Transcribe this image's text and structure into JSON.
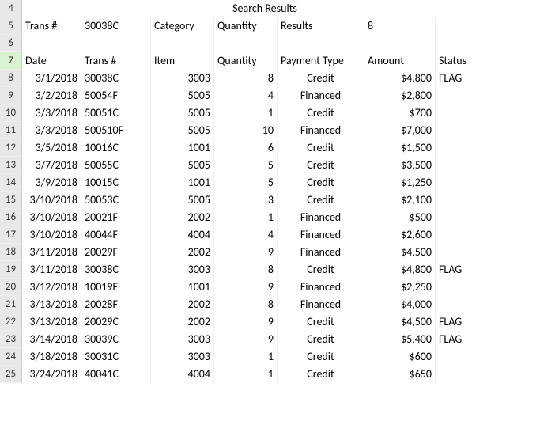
{
  "title": "Search Results",
  "rowNumbers": [
    4,
    5,
    6,
    7,
    8,
    9,
    10,
    11,
    12,
    13,
    14,
    15,
    16,
    17,
    18,
    19,
    20,
    21,
    22,
    23,
    24,
    25
  ],
  "search": {
    "transLabel": "Trans #",
    "transValue": "30038C",
    "categoryLabel": "Category",
    "quantityLabel": "Quantity",
    "resultsLabel": "Results",
    "resultsValue": "8"
  },
  "headers": {
    "date": "Date",
    "trans": "Trans #",
    "item": "Item",
    "quantity": "Quantity",
    "payment": "Payment Type",
    "amount": "Amount",
    "status": "Status"
  },
  "rows": [
    {
      "date": "3/1/2018",
      "trans": "30038C",
      "item": "3003",
      "qty": "8",
      "pay": "Credit",
      "amt": "$4,800",
      "status": "FLAG"
    },
    {
      "date": "3/2/2018",
      "trans": "50054F",
      "item": "5005",
      "qty": "4",
      "pay": "Financed",
      "amt": "$2,800",
      "status": ""
    },
    {
      "date": "3/3/2018",
      "trans": "50051C",
      "item": "5005",
      "qty": "1",
      "pay": "Credit",
      "amt": "$700",
      "status": ""
    },
    {
      "date": "3/3/2018",
      "trans": "500510F",
      "item": "5005",
      "qty": "10",
      "pay": "Financed",
      "amt": "$7,000",
      "status": ""
    },
    {
      "date": "3/5/2018",
      "trans": "10016C",
      "item": "1001",
      "qty": "6",
      "pay": "Credit",
      "amt": "$1,500",
      "status": ""
    },
    {
      "date": "3/7/2018",
      "trans": "50055C",
      "item": "5005",
      "qty": "5",
      "pay": "Credit",
      "amt": "$3,500",
      "status": ""
    },
    {
      "date": "3/9/2018",
      "trans": "10015C",
      "item": "1001",
      "qty": "5",
      "pay": "Credit",
      "amt": "$1,250",
      "status": ""
    },
    {
      "date": "3/10/2018",
      "trans": "50053C",
      "item": "5005",
      "qty": "3",
      "pay": "Credit",
      "amt": "$2,100",
      "status": ""
    },
    {
      "date": "3/10/2018",
      "trans": "20021F",
      "item": "2002",
      "qty": "1",
      "pay": "Financed",
      "amt": "$500",
      "status": ""
    },
    {
      "date": "3/10/2018",
      "trans": "40044F",
      "item": "4004",
      "qty": "4",
      "pay": "Financed",
      "amt": "$2,600",
      "status": ""
    },
    {
      "date": "3/11/2018",
      "trans": "20029F",
      "item": "2002",
      "qty": "9",
      "pay": "Financed",
      "amt": "$4,500",
      "status": ""
    },
    {
      "date": "3/11/2018",
      "trans": "30038C",
      "item": "3003",
      "qty": "8",
      "pay": "Credit",
      "amt": "$4,800",
      "status": "FLAG"
    },
    {
      "date": "3/12/2018",
      "trans": "10019F",
      "item": "1001",
      "qty": "9",
      "pay": "Financed",
      "amt": "$2,250",
      "status": ""
    },
    {
      "date": "3/13/2018",
      "trans": "20028F",
      "item": "2002",
      "qty": "8",
      "pay": "Financed",
      "amt": "$4,000",
      "status": ""
    },
    {
      "date": "3/13/2018",
      "trans": "20029C",
      "item": "2002",
      "qty": "9",
      "pay": "Credit",
      "amt": "$4,500",
      "status": "FLAG"
    },
    {
      "date": "3/14/2018",
      "trans": "30039C",
      "item": "3003",
      "qty": "9",
      "pay": "Credit",
      "amt": "$5,400",
      "status": "FLAG"
    },
    {
      "date": "3/18/2018",
      "trans": "30031C",
      "item": "3003",
      "qty": "1",
      "pay": "Credit",
      "amt": "$600",
      "status": ""
    },
    {
      "date": "3/24/2018",
      "trans": "40041C",
      "item": "4004",
      "qty": "1",
      "pay": "Credit",
      "amt": "$650",
      "status": ""
    }
  ]
}
